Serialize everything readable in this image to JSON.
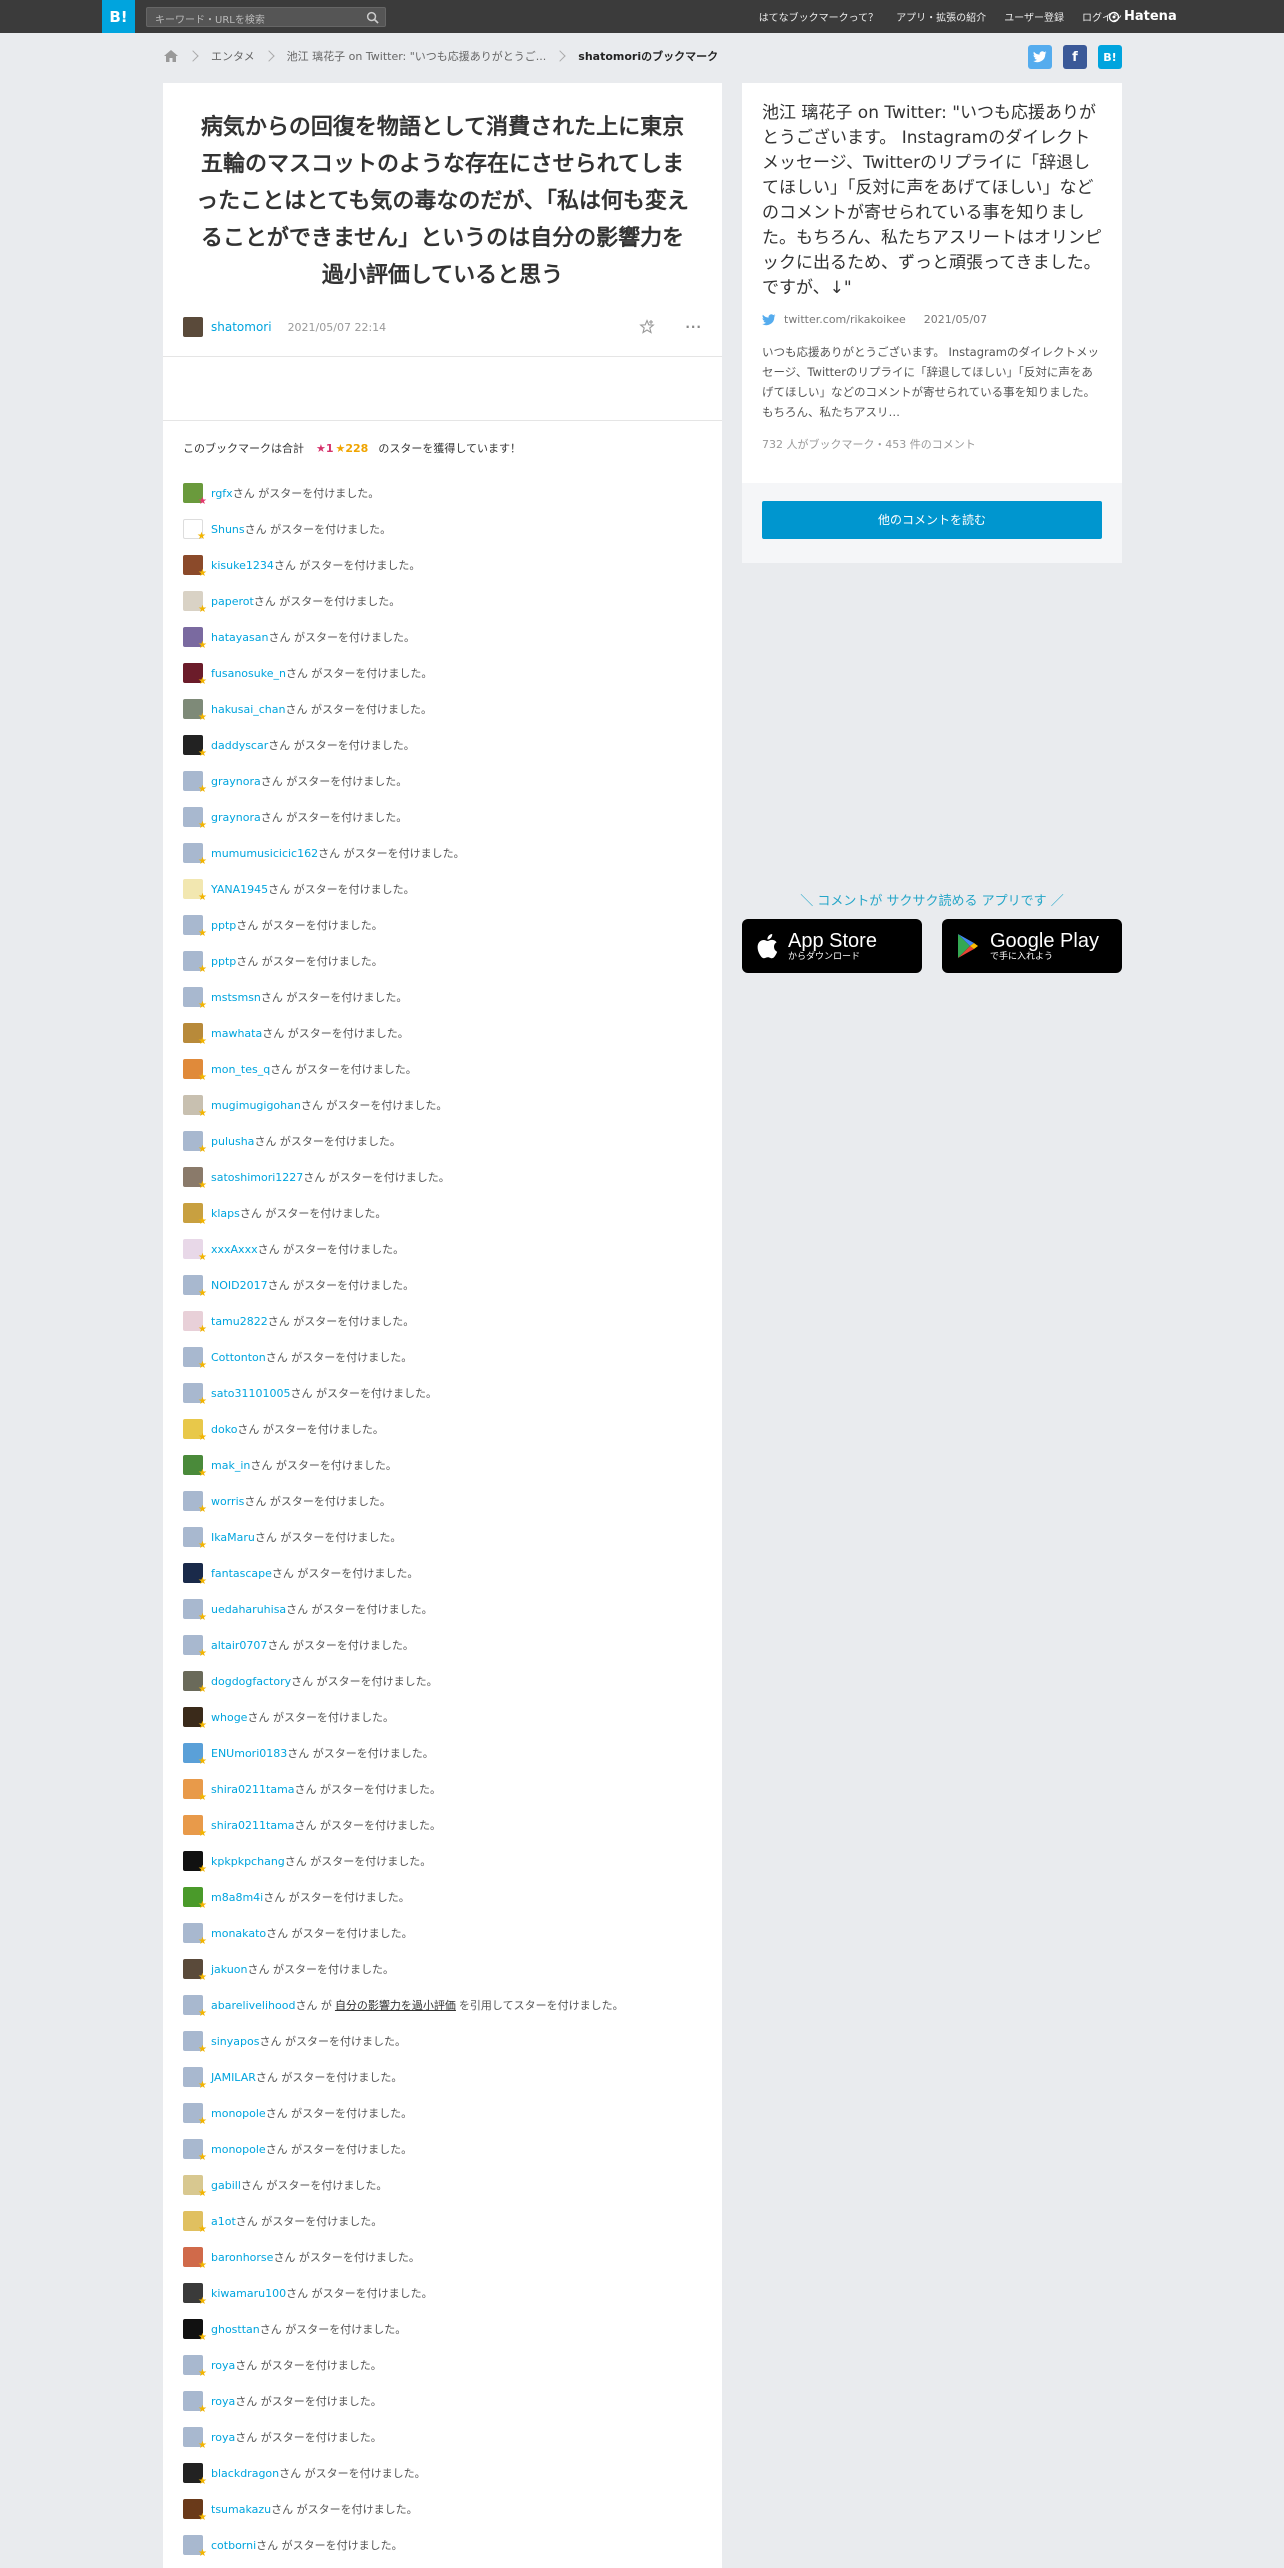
{
  "header": {
    "logo": "B!",
    "search_placeholder": "キーワード・URLを検索",
    "nav": [
      "はてなブックマークって？",
      "アプリ・拡張の紹介",
      "ユーザー登録",
      "ログイン"
    ],
    "brand": "Hatena"
  },
  "breadcrumb": {
    "items": [
      "エンタメ",
      "池江 璃花子 on Twitter: \"いつも応援ありがとうご...",
      "shatomoriのブックマーク"
    ]
  },
  "share": {
    "twitter": "t",
    "facebook": "f",
    "hatena": "B!"
  },
  "comment": {
    "text": "病気からの回復を物語として消費された上に東京五輪のマスコットのような存在にさせられてしまったことはとても気の毒なのだが、「私は何も変えることができません」というのは自分の影響力を過小評価していると思う",
    "user": "shatomori",
    "datetime": "2021/05/07 22:14",
    "more": "···"
  },
  "stars_summary": {
    "prefix": "このブックマークは合計",
    "red": "★1",
    "yellow": "★228",
    "suffix": "のスターを獲得しています！"
  },
  "star_suffix": "さん がスターを付けました。",
  "quote": {
    "user": "abarelivelihood",
    "mid": "さん が",
    "text": "自分の影響力を過小評価",
    "end": "を引用してスターを付けました。"
  },
  "star_users": [
    {
      "name": "rgfx",
      "color": "#6a9a3c",
      "red": true
    },
    {
      "name": "Shuns",
      "color": "#ffffff"
    },
    {
      "name": "kisuke1234",
      "color": "#8b4a2a"
    },
    {
      "name": "paperot",
      "color": "#d9d2c5"
    },
    {
      "name": "hatayasan",
      "color": "#7a6aa0"
    },
    {
      "name": "fusanosuke_n",
      "color": "#6b1c2a"
    },
    {
      "name": "hakusai_chan",
      "color": "#7e8a78"
    },
    {
      "name": "daddyscar",
      "color": "#222222"
    },
    {
      "name": "graynora",
      "color": "#a8b8cf"
    },
    {
      "name": "graynora",
      "color": "#a8b8cf"
    },
    {
      "name": "mumumusicicic162",
      "color": "#a8b8cf"
    },
    {
      "name": "YANA1945",
      "color": "#f2e7b0"
    },
    {
      "name": "pptp",
      "color": "#a8b8cf"
    },
    {
      "name": "pptp",
      "color": "#a8b8cf"
    },
    {
      "name": "mstsmsn",
      "color": "#a8b8cf"
    },
    {
      "name": "mawhata",
      "color": "#b88a3a"
    },
    {
      "name": "mon_tes_q",
      "color": "#e08a3a"
    },
    {
      "name": "mugimugigohan",
      "color": "#c8c0b0"
    },
    {
      "name": "pulusha",
      "color": "#a8b8cf"
    },
    {
      "name": "satoshimori1227",
      "color": "#8a7a6a"
    },
    {
      "name": "klaps",
      "color": "#c8a040"
    },
    {
      "name": "xxxAxxx",
      "color": "#e8d8e8"
    },
    {
      "name": "NOID2017",
      "color": "#a8b8cf"
    },
    {
      "name": "tamu2822",
      "color": "#e8d0d8"
    },
    {
      "name": "Cottonton",
      "color": "#a8b8cf"
    },
    {
      "name": "sato31101005",
      "color": "#a8b8cf"
    },
    {
      "name": "doko",
      "color": "#e8c84a"
    },
    {
      "name": "mak_in",
      "color": "#4a8a3a"
    },
    {
      "name": "worris",
      "color": "#a8b8cf"
    },
    {
      "name": "IkaMaru",
      "color": "#a8b8cf"
    },
    {
      "name": "fantascape",
      "color": "#1a2a4a"
    },
    {
      "name": "uedaharuhisa",
      "color": "#a8b8cf"
    },
    {
      "name": "altair0707",
      "color": "#a8b8cf"
    },
    {
      "name": "dogdogfactory",
      "color": "#6a6a5a"
    },
    {
      "name": "whoge",
      "color": "#3a2a1a"
    },
    {
      "name": "ENUmori0183",
      "color": "#5aa0d8"
    },
    {
      "name": "shira0211tama",
      "color": "#e89a4a"
    },
    {
      "name": "shira0211tama",
      "color": "#e89a4a"
    },
    {
      "name": "kpkpkpchang",
      "color": "#111111"
    },
    {
      "name": "m8a8m4i",
      "color": "#4a9a2a"
    },
    {
      "name": "monakato",
      "color": "#a8b8cf"
    },
    {
      "name": "jakuon",
      "color": "#5a4a3a"
    },
    {
      "name": "abarelivelihood",
      "color": "#a8b8cf",
      "quote": true
    },
    {
      "name": "sinyapos",
      "color": "#a8b8cf"
    },
    {
      "name": "JAMILAR",
      "color": "#a8b8cf"
    },
    {
      "name": "monopole",
      "color": "#a8b8cf"
    },
    {
      "name": "monopole",
      "color": "#a8b8cf"
    },
    {
      "name": "gabill",
      "color": "#d8c890"
    },
    {
      "name": "a1ot",
      "color": "#e0c060"
    },
    {
      "name": "baronhorse",
      "color": "#d06a4a"
    },
    {
      "name": "kiwamaru100",
      "color": "#3a3a3a"
    },
    {
      "name": "ghosttan",
      "color": "#111111"
    },
    {
      "name": "roya",
      "color": "#a8b8cf"
    },
    {
      "name": "roya",
      "color": "#a8b8cf"
    },
    {
      "name": "roya",
      "color": "#a8b8cf"
    },
    {
      "name": "blackdragon",
      "color": "#222222"
    },
    {
      "name": "tsumakazu",
      "color": "#6a3a1a"
    },
    {
      "name": "cotborni",
      "color": "#a8b8cf"
    }
  ],
  "entry": {
    "title": "池江 璃花子 on Twitter: \"いつも応援ありがとうございます。 Instagramのダイレクトメッセージ、Twitterのリプライに「辞退してほしい」「反対に声をあげてほしい」などのコメントが寄せられている事を知りました。もちろん、私たちアスリートはオリンピックに出るため、ずっと頑張ってきました。ですが、↓\"",
    "source": "twitter.com/rikakoikee",
    "date": "2021/05/07",
    "description": "いつも応援ありがとうございます。 Instagramのダイレクトメッセージ、Twitterのリプライに「辞退してほしい」「反対に声をあげてほしい」などのコメントが寄せられている事を知りました。もちろん、私たちアスリ…",
    "counts": "732 人がブックマーク・453 件のコメント",
    "more_button": "他のコメントを読む"
  },
  "app_promo": {
    "text": "＼ コメントが サクサク読める アプリです ／",
    "appstore_big": "App Store",
    "appstore_small": "からダウンロード",
    "googleplay_big": "Google Play",
    "googleplay_small": "で手に入れよう"
  },
  "colors": {
    "accent": "#00a4de",
    "twitter": "#55acee",
    "facebook": "#3b5998",
    "star_yellow": "#f2b400",
    "star_red": "#e3396e"
  }
}
